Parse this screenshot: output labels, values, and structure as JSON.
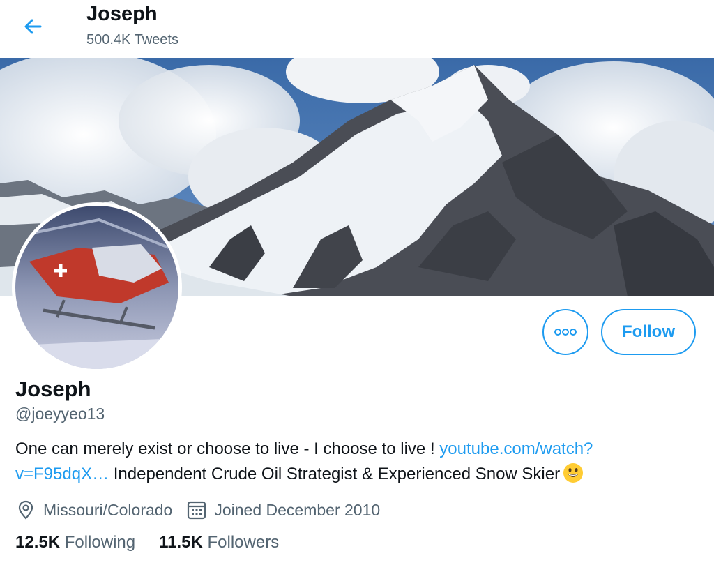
{
  "header": {
    "name": "Joseph",
    "tweet_count": "500.4K Tweets"
  },
  "profile": {
    "display_name": "Joseph",
    "handle": "@joeyyeo13",
    "bio_text_1": "One can merely exist or choose to live - I choose to live ! ",
    "bio_link": "youtube.com/watch?v=F95dqX…",
    "bio_text_2": " Independent Crude Oil Strategist &  Experienced Snow Skier",
    "location": "Missouri/Colorado",
    "joined": "Joined December 2010"
  },
  "actions": {
    "follow_label": "Follow"
  },
  "stats": {
    "following_count": "12.5K",
    "following_label": "Following",
    "followers_count": "11.5K",
    "followers_label": "Followers"
  },
  "colors": {
    "accent": "#1d9bf0",
    "secondary_text": "#536471"
  },
  "icons": {
    "back": "back-arrow-icon",
    "more": "more-options-icon",
    "location": "location-pin-icon",
    "joined": "calendar-icon",
    "emoji": "grinning-face-emoji"
  }
}
